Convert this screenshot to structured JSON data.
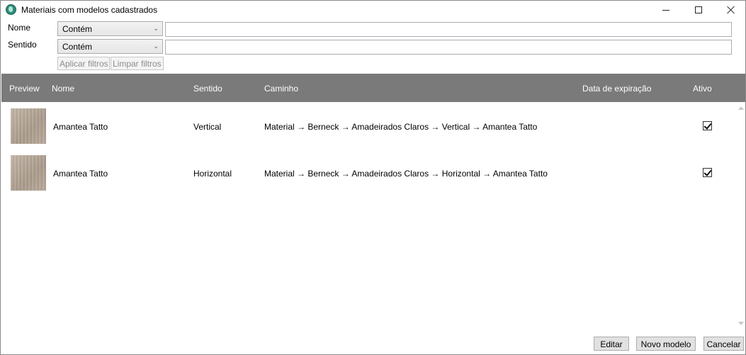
{
  "window": {
    "title": "Materiais com modelos cadastrados",
    "icon": "app-globe-icon"
  },
  "filters": {
    "nome_label": "Nome",
    "sentido_label": "Sentido",
    "nome_operator": "Contém",
    "sentido_operator": "Contém",
    "nome_value": "",
    "sentido_value": "",
    "apply_label": "Aplicar filtros",
    "clear_label": "Limpar filtros"
  },
  "grid": {
    "columns": [
      "Preview",
      "Nome",
      "Sentido",
      "Caminho",
      "Data de expiração",
      "Ativo"
    ],
    "rows": [
      {
        "nome": "Amantea Tatto",
        "sentido": "Vertical",
        "caminho": "Material → Berneck → Amadeirados Claros → Vertical → Amantea Tatto",
        "data_expiracao": "",
        "ativo": true
      },
      {
        "nome": "Amantea Tatto",
        "sentido": "Horizontal",
        "caminho": "Material → Berneck → Amadeirados Claros → Horizontal → Amantea Tatto",
        "data_expiracao": "",
        "ativo": true
      }
    ]
  },
  "actions": {
    "edit_label": "Editar",
    "new_label": "Novo modelo",
    "cancel_label": "Cancelar"
  },
  "colors": {
    "header_bg": "#7a7a7a",
    "header_text": "#ffffff",
    "disabled_text": "#8c8c8c"
  }
}
